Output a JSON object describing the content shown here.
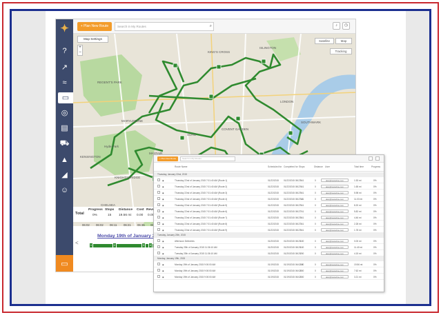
{
  "app": {
    "plan_button": "+ Plan New Route",
    "search_placeholder": "Search in My Routes",
    "map_settings": "Map Settings",
    "satellite_label": "Satellite",
    "map_label": "Map",
    "tracking_label": "Tracking",
    "zoom_in": "+",
    "zoom_out": "−"
  },
  "stats": {
    "total_label": "Total",
    "headers": [
      "Progress",
      "Stops",
      "Distance",
      "Cost",
      "Revenue"
    ],
    "values": [
      "0%",
      "15",
      "19.56 mi",
      "0.00",
      "0.00"
    ]
  },
  "timeline": {
    "times": [
      "06:02",
      "06:02",
      "06:11",
      "06:21",
      "06:35",
      "06:3"
    ],
    "day_title": "Monday 19th of January 2015",
    "stops": [
      "1",
      "2",
      "3",
      "4"
    ]
  },
  "map_labels": [
    "REGENT'S PARK",
    "MARYLEBONE",
    "KING'S CROSS",
    "ISLINGTON",
    "SOHO",
    "MAYFAIR",
    "COVENT GARDEN",
    "LONDON",
    "SOUTHWARK",
    "WESTMINSTER",
    "KNIGHTSBRIDGE",
    "CHELSEA",
    "KENSINGTON",
    "BELGRAVIA",
    "LAMBETH",
    "Hyde Park"
  ],
  "table": {
    "plan_button": "+ Plan New Route",
    "search_placeholder": "Search in My Routes",
    "headers": [
      "Route Name",
      "Scheduled for",
      "Completed for",
      "Stops",
      "Distance",
      "User",
      "Total time",
      "Progress"
    ],
    "groups": [
      {
        "title": "Thursday, January 22nd, 2015",
        "rows": [
          [
            "Thursday 22nd of January 2015 7:01:40 AM (Route 1)",
            "01/22/2015",
            "01/22/2015 08:27:41",
            "6",
            "0",
            "alex@route4me.com",
            "1.53 mi",
            "0%"
          ],
          [
            "Thursday 22nd of January 2015 7:01:40 AM (Route 2)",
            "01/22/2015",
            "01/22/2015 08:27:41",
            "4",
            "0",
            "alex@route4me.com",
            "1.65 mi",
            "0%"
          ],
          [
            "Thursday 22nd of January 2015 7:01:40 AM (Route 3)",
            "01/22/2015",
            "01/22/2015 08:27:41",
            "5",
            "0",
            "alex@route4me.com",
            "5.98 mi",
            "0%"
          ],
          [
            "Thursday 22nd of January 2015 7:01:40 AM (Route 4)",
            "01/22/2015",
            "01/22/2015 08:27:41",
            "12",
            "0",
            "alex@route4me.com",
            "11.03 mi",
            "0%"
          ],
          [
            "Thursday 22nd of January 2015 7:01:40 AM (Route 5)",
            "01/22/2015",
            "01/22/2015 08:27:41",
            "9",
            "0",
            "alex@route4me.com",
            "8.20 mi",
            "0%"
          ],
          [
            "Thursday 22nd of January 2015 7:01:40 AM (Route 6)",
            "01/22/2015",
            "01/22/2015 08:27:41",
            "7",
            "0",
            "alex@route4me.com",
            "5.82 mi",
            "0%"
          ],
          [
            "Thursday 22nd of January 2015 7:01:40 AM (Route 7)",
            "01/22/2015",
            "01/22/2015 08:27:41",
            "8",
            "0",
            "alex@route4me.com",
            "4.46 mi",
            "0%"
          ],
          [
            "Thursday 22nd of January 2015 7:01:40 AM (Route 8)",
            "01/22/2015",
            "01/22/2015 08:27:41",
            "3",
            "0",
            "alex@route4me.com",
            "2.28 mi",
            "0%"
          ],
          [
            "Thursday 22nd of January 2015 7:01:40 AM (Route 9)",
            "01/22/2015",
            "01/22/2015 08:27:41",
            "6",
            "0",
            "alex@route4me.com",
            "1.78 mi",
            "0%"
          ]
        ]
      },
      {
        "title": "Tuesday, January 20th, 2015",
        "rows": [
          [
            "Afternoon Deliveries",
            "01/20/2015",
            "01/20/2015 08:20:00",
            "1",
            "0",
            "alex@route4me.com",
            "0.00 mi",
            "0%"
          ],
          [
            "Tuesday 20th of January 2015 11:36:10 AM",
            "01/20/2015",
            "01/20/2015 08:20:00",
            "1",
            "0",
            "alex@route4me.com",
            "11.40 mi",
            "0%"
          ],
          [
            "Tuesday 20th of January 2015 11:36:10 AM",
            "01/20/2015",
            "01/20/2015 08:20:00",
            "2",
            "0",
            "alex@route4me.com",
            "4.15 mi",
            "0%"
          ]
        ]
      },
      {
        "title": "Monday, January 19th, 2015",
        "rows": [
          [
            "Monday 19th of January 2015 9:00:00 AM",
            "01/19/2015",
            "01/19/2015 06:02:00",
            "15",
            "0",
            "alex@route4me.com",
            "19.56 mi",
            "0%"
          ],
          [
            "Monday 19th of January 2015 9:00:00 AM",
            "01/19/2015",
            "01/19/2015 06:02:00",
            "8",
            "0",
            "alex@route4me.com",
            "7.62 mi",
            "0%"
          ],
          [
            "Monday 19th of January 2015 9:00:00 AM",
            "01/19/2015",
            "01/19/2015 06:02:00",
            "5",
            "0",
            "alex@route4me.com",
            "3.21 mi",
            "0%"
          ]
        ]
      }
    ]
  },
  "colors": {
    "sidebar": "#3c4a6c",
    "accent": "#f39c2a",
    "route": "#2f8a2f",
    "river": "#a9cce8",
    "park": "#b8d9a0"
  }
}
